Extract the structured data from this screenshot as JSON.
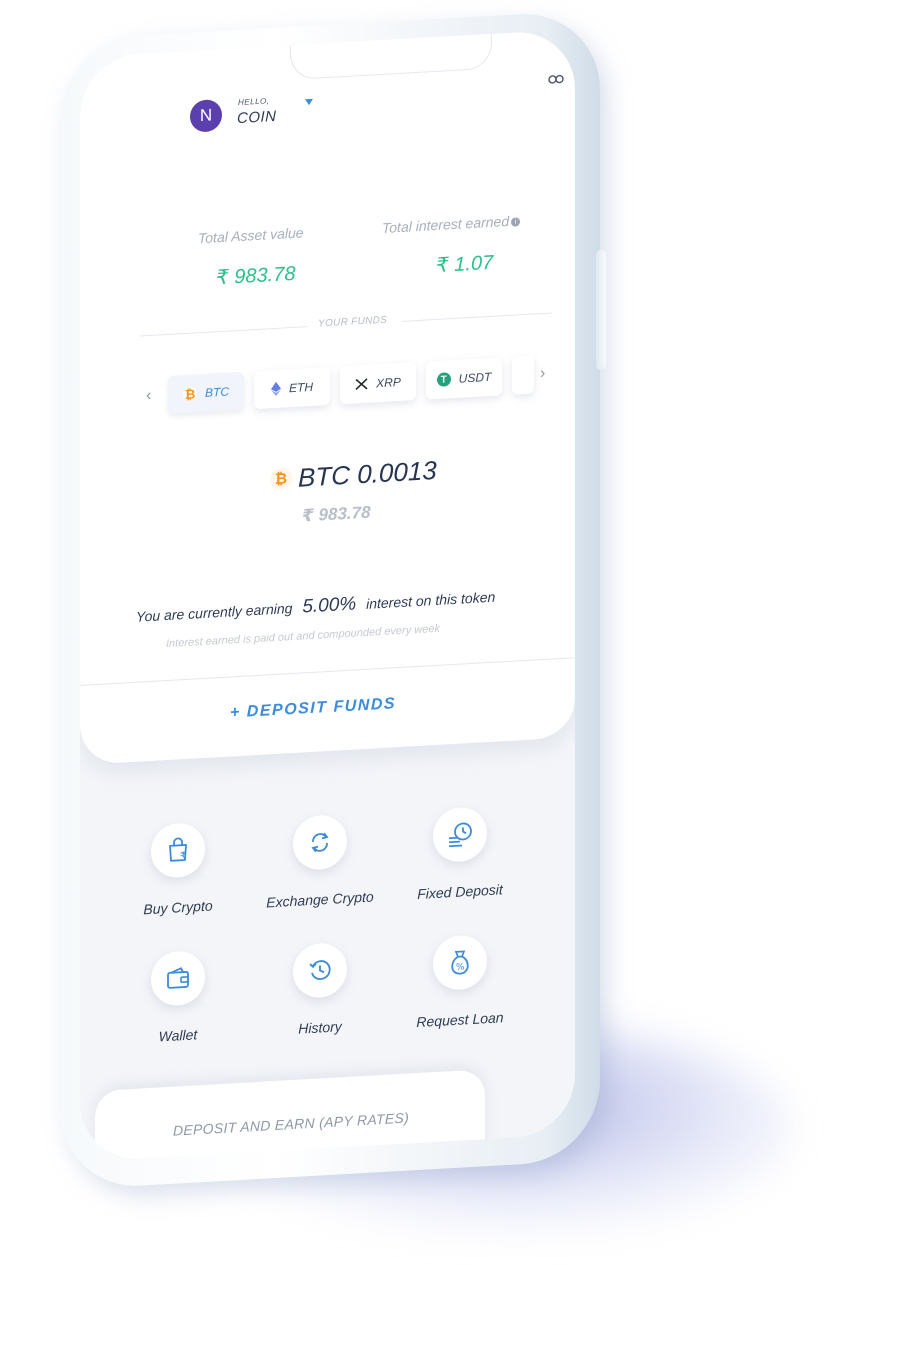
{
  "header": {
    "avatar_initial": "N",
    "greeting": "HELLO,",
    "username": "COIN"
  },
  "summary": {
    "asset_label": "Total Asset value",
    "asset_value": "₹ 983.78",
    "interest_label": "Total interest earned",
    "interest_value": "₹ 1.07"
  },
  "funds": {
    "section_label": "YOUR FUNDS",
    "tokens": [
      {
        "label": "BTC",
        "icon": "bitcoin-icon",
        "color": "#f7931a",
        "active": true
      },
      {
        "label": "ETH",
        "icon": "ethereum-icon",
        "color": "#627eea",
        "active": false
      },
      {
        "label": "XRP",
        "icon": "xrp-icon",
        "color": "#23292f",
        "active": false
      },
      {
        "label": "USDT",
        "icon": "tether-icon",
        "color": "#26a17b",
        "active": false
      }
    ]
  },
  "selected": {
    "amount": "BTC 0.0013",
    "fiat": "₹ 983.78",
    "earning_prefix": "You are currently earning",
    "rate": "5.00%",
    "earning_suffix": "interest on this token",
    "note": "Interest earned is paid out and compounded every week"
  },
  "deposit_button": "+ DEPOSIT FUNDS",
  "actions": [
    {
      "label": "Buy Crypto",
      "icon": "buy-crypto-icon"
    },
    {
      "label": "Exchange Crypto",
      "icon": "exchange-icon"
    },
    {
      "label": "Fixed Deposit",
      "icon": "fixed-deposit-icon"
    },
    {
      "label": "Wallet",
      "icon": "wallet-icon"
    },
    {
      "label": "History",
      "icon": "history-icon"
    },
    {
      "label": "Request Loan",
      "icon": "loan-icon"
    }
  ],
  "bottom_section": "DEPOSIT AND EARN (APY RATES)",
  "colors": {
    "accent": "#3b8bde",
    "positive": "#29c08a",
    "avatar": "#5b3fae"
  }
}
